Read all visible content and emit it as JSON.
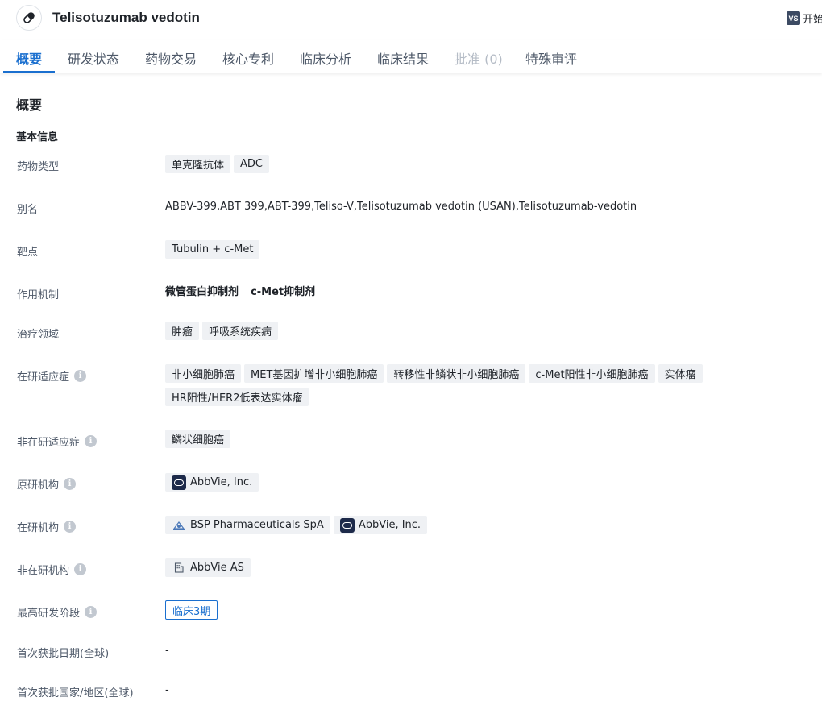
{
  "header": {
    "drug_name": "Telisotuzumab vedotin",
    "start_icon_text": "VS",
    "start_label": "开始"
  },
  "tabs": [
    {
      "label": "概要",
      "active": true
    },
    {
      "label": "研发状态"
    },
    {
      "label": "药物交易"
    },
    {
      "label": "核心专利"
    },
    {
      "label": "临床分析"
    },
    {
      "label": "临床结果"
    },
    {
      "label": "批准 (0)",
      "disabled": true
    },
    {
      "label": "特殊审评"
    }
  ],
  "overview": {
    "title": "概要",
    "basic_info_title": "基本信息",
    "rows": {
      "drug_type": {
        "label": "药物类型",
        "tags": [
          "单克隆抗体",
          "ADC"
        ]
      },
      "alias": {
        "label": "别名",
        "value": "ABBV-399,ABT 399,ABT-399,Teliso-V,Telisotuzumab vedotin (USAN),Telisotuzumab-vedotin"
      },
      "target": {
        "label": "靶点",
        "tags": [
          "Tubulin + c-Met"
        ]
      },
      "mechanism": {
        "label": "作用机制",
        "values": [
          "微管蛋白抑制剂",
          "c-Met抑制剂"
        ]
      },
      "therapeutic_area": {
        "label": "治疗领域",
        "tags": [
          "肿瘤",
          "呼吸系统疾病"
        ]
      },
      "active_indications": {
        "label": "在研适应症",
        "tags": [
          "非小细胞肺癌",
          "MET基因扩增非小细胞肺癌",
          "转移性非鳞状非小细胞肺癌",
          "c-Met阳性非小细胞肺癌",
          "实体瘤",
          "HR阳性/HER2低表达实体瘤"
        ]
      },
      "inactive_indications": {
        "label": "非在研适应症",
        "tags": [
          "鳞状细胞癌"
        ]
      },
      "originator": {
        "label": "原研机构",
        "orgs": [
          "AbbVie, Inc."
        ]
      },
      "active_orgs": {
        "label": "在研机构",
        "orgs": [
          "BSP Pharmaceuticals SpA",
          "AbbVie, Inc."
        ]
      },
      "inactive_orgs": {
        "label": "非在研机构",
        "orgs": [
          "AbbVie AS"
        ]
      },
      "highest_phase": {
        "label": "最高研发阶段",
        "value": "临床3期"
      },
      "first_approval_date": {
        "label": "首次获批日期(全球)",
        "value": "-"
      },
      "first_approval_country": {
        "label": "首次获批国家/地区(全球)",
        "value": "-"
      }
    }
  },
  "info_icon_glyph": "i",
  "colors": {
    "accent": "#1a6fcf",
    "tag_bg": "#eff1f4",
    "label": "#4e5969"
  }
}
